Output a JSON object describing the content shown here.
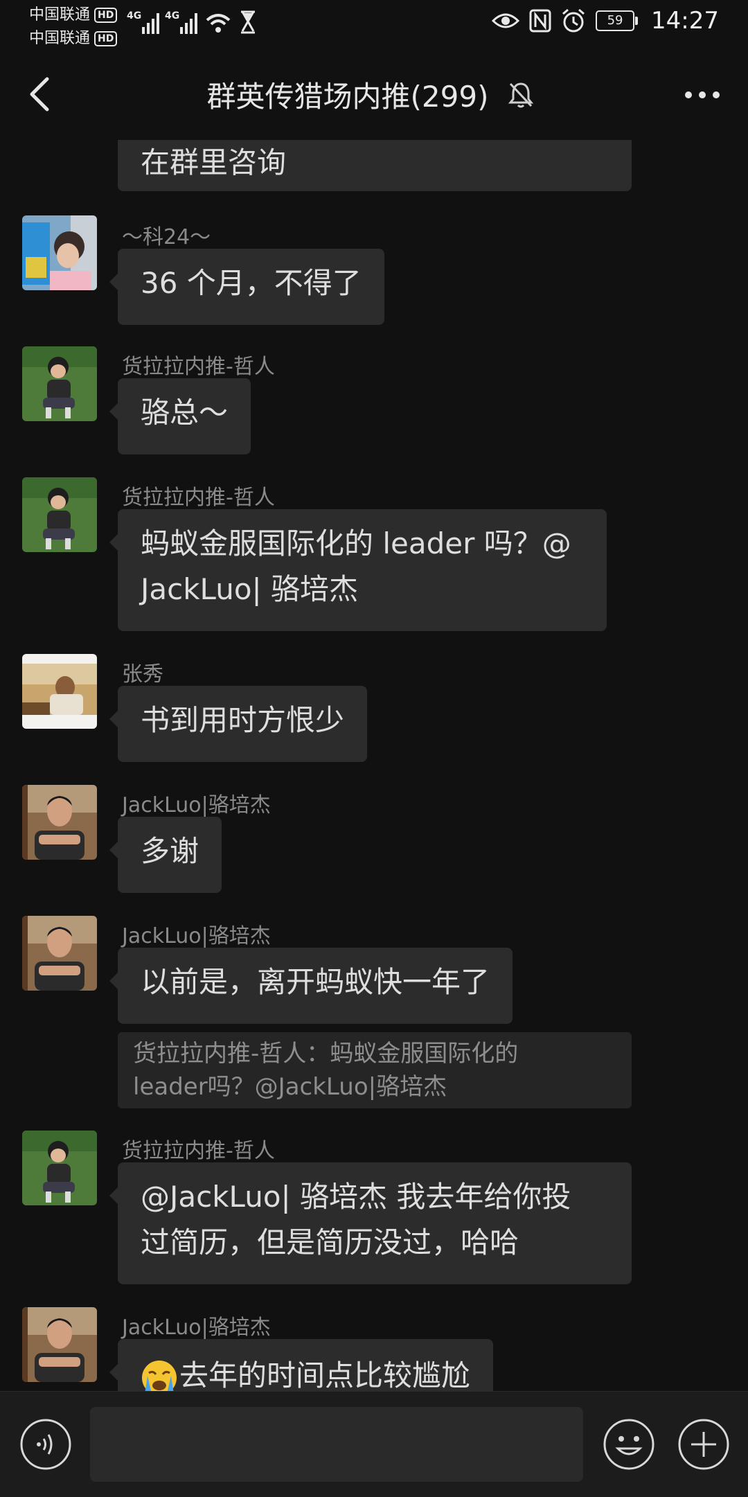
{
  "status_bar": {
    "carrier_1": "中国联通",
    "carrier_2": "中国联通",
    "hd_label": "HD",
    "network_1": "4G",
    "network_2": "4G",
    "battery_level": "59",
    "time": "14:27"
  },
  "header": {
    "title": "群英传猎场内推(299)"
  },
  "messages": [
    {
      "sender": "",
      "text": "在群里咨询",
      "avatar": "avatar-prev"
    },
    {
      "sender": "～科24～",
      "text": "36 个月，不得了",
      "avatar": "avatar-child"
    },
    {
      "sender": "货拉拉内推-哲人",
      "text": "骆总～",
      "avatar": "avatar-zheren"
    },
    {
      "sender": "货拉拉内推-哲人",
      "text_line1": "蚂蚁金服国际化的 leader 吗？@",
      "text_line2": "JackLuo| 骆培杰",
      "avatar": "avatar-zheren"
    },
    {
      "sender": "张秀",
      "text": "书到用时方恨少",
      "avatar": "avatar-zhangxiu"
    },
    {
      "sender": "JackLuo|骆培杰",
      "text": "多谢",
      "avatar": "avatar-jackluo"
    },
    {
      "sender": "JackLuo|骆培杰",
      "text": "以前是，离开蚂蚁快一年了",
      "quote_line1": "货拉拉内推-哲人：蚂蚁金服国际化的",
      "quote_line2": "leader吗？@JackLuo|骆培杰",
      "avatar": "avatar-jackluo"
    },
    {
      "sender": "货拉拉内推-哲人",
      "text_line1": "@JackLuo| 骆培杰 我去年给你投",
      "text_line2": "过简历，但是简历没过，哈哈",
      "avatar": "avatar-zheren"
    },
    {
      "sender": "JackLuo|骆培杰",
      "text": "去年的时间点比较尴尬",
      "emoji": "loudly-crying-face-icon",
      "avatar": "avatar-jackluo"
    }
  ],
  "input_bar": {
    "placeholder": ""
  },
  "colors": {
    "background": "#111111",
    "bubble": "#2c2c2c",
    "quote": "#252525",
    "input_bar": "#1c1c1c"
  }
}
